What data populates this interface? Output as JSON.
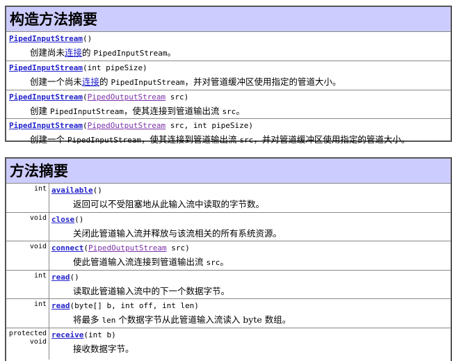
{
  "constructor_summary": {
    "title": "构造方法摘要",
    "rows": [
      {
        "name": "PipedInputStream",
        "sig_pre": "(",
        "param_type": "",
        "sig_post": ")",
        "desc": [
          {
            "t": "创建尚未",
            "k": "text"
          },
          {
            "t": "连接",
            "k": "link"
          },
          {
            "t": "的 ",
            "k": "text"
          },
          {
            "t": "PipedInputStream",
            "k": "mono"
          },
          {
            "t": "。",
            "k": "text"
          }
        ]
      },
      {
        "name": "PipedInputStream",
        "sig_pre": "(int pipeSize)",
        "param_type": "",
        "sig_post": "",
        "desc": [
          {
            "t": "创建一个尚未",
            "k": "text"
          },
          {
            "t": "连接",
            "k": "link"
          },
          {
            "t": "的 ",
            "k": "text"
          },
          {
            "t": "PipedInputStream",
            "k": "mono"
          },
          {
            "t": "，并对管道缓冲区使用指定的管道大小。",
            "k": "text"
          }
        ]
      },
      {
        "name": "PipedInputStream",
        "sig_pre": "(",
        "param_type": "PipedOutputStream",
        "sig_post": " src)",
        "desc": [
          {
            "t": "创建 ",
            "k": "text"
          },
          {
            "t": "PipedInputStream",
            "k": "mono"
          },
          {
            "t": "，使其连接到管道输出流 ",
            "k": "text"
          },
          {
            "t": "src",
            "k": "mono"
          },
          {
            "t": "。",
            "k": "text"
          }
        ]
      },
      {
        "name": "PipedInputStream",
        "sig_pre": "(",
        "param_type": "PipedOutputStream",
        "sig_post": " src, int pipeSize)",
        "desc": [
          {
            "t": "创建一个 ",
            "k": "text"
          },
          {
            "t": "PipedInputStream",
            "k": "mono"
          },
          {
            "t": "，使其连接到管道输出流 ",
            "k": "text"
          },
          {
            "t": "src",
            "k": "mono"
          },
          {
            "t": "，并对管道缓冲区使用指定的管道大小。",
            "k": "text"
          }
        ]
      }
    ]
  },
  "method_summary": {
    "title": "方法摘要",
    "rows": [
      {
        "type_lines": [
          "int"
        ],
        "name": "available",
        "sig_pre": "()",
        "param_type": "",
        "sig_post": "",
        "desc": [
          {
            "t": "返回可以不受阻塞地从此输入流中读取的字节数。",
            "k": "text"
          }
        ]
      },
      {
        "type_lines": [
          "void"
        ],
        "name": "close",
        "sig_pre": "()",
        "param_type": "",
        "sig_post": "",
        "desc": [
          {
            "t": "关闭此管道输入流并释放与该流相关的所有系统资源。",
            "k": "text"
          }
        ]
      },
      {
        "type_lines": [
          "void"
        ],
        "name": "connect",
        "sig_pre": "(",
        "param_type": "PipedOutputStream",
        "sig_post": " src)",
        "desc": [
          {
            "t": "使此管道输入流连接到管道输出流 ",
            "k": "text"
          },
          {
            "t": "src",
            "k": "mono"
          },
          {
            "t": "。",
            "k": "text"
          }
        ]
      },
      {
        "type_lines": [
          "int"
        ],
        "name": "read",
        "sig_pre": "()",
        "param_type": "",
        "sig_post": "",
        "desc": [
          {
            "t": "读取此管道输入流中的下一个数据字节。",
            "k": "text"
          }
        ]
      },
      {
        "type_lines": [
          "int"
        ],
        "name": "read",
        "sig_pre": "(byte[] b, int off, int len)",
        "param_type": "",
        "sig_post": "",
        "desc": [
          {
            "t": "将最多 ",
            "k": "text"
          },
          {
            "t": "len",
            "k": "mono"
          },
          {
            "t": " 个数据字节从此管道输入流读入 byte 数组。",
            "k": "text"
          }
        ]
      },
      {
        "type_lines": [
          "protected",
          "void"
        ],
        "name": "receive",
        "sig_pre": "(int b)",
        "param_type": "",
        "sig_post": "",
        "desc": [
          {
            "t": "接收数据字节。",
            "k": "text"
          }
        ]
      }
    ]
  }
}
